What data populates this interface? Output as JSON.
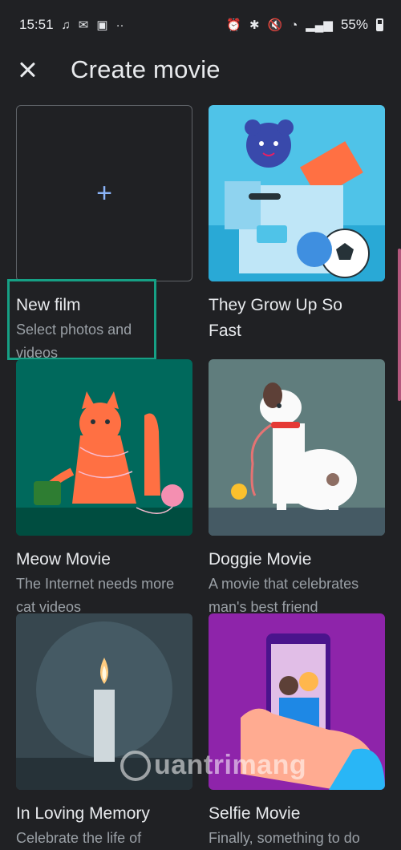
{
  "status_bar": {
    "time": "15:51",
    "battery": "55%",
    "left_icons": [
      "music-note-icon",
      "email-icon",
      "image-icon",
      "more-dots-icon"
    ],
    "right_icons": [
      "alarm-icon",
      "bluetooth-icon",
      "mute-icon",
      "wifi-icon",
      "volte-icon",
      "signal-icon",
      "battery-icon"
    ]
  },
  "app_bar": {
    "title": "Create movie"
  },
  "cards": [
    {
      "name": "New film",
      "sub": "Select photos and\nvideos"
    },
    {
      "name": "They Grow Up So\nFast",
      "sub": ""
    },
    {
      "name": "Meow Movie",
      "sub": "The Internet needs more\ncat videos"
    },
    {
      "name": "Doggie Movie",
      "sub": "A movie that celebrates\nman's best friend"
    },
    {
      "name": "In Loving Memory",
      "sub": "Celebrate the life of"
    },
    {
      "name": "Selfie Movie",
      "sub": "Finally, something to do"
    }
  ],
  "new_film_plus": "+",
  "watermark": "uantrimang",
  "colors": {
    "background": "#202124",
    "accent_blue": "#8ab4f8",
    "highlight_green": "#16a085"
  }
}
